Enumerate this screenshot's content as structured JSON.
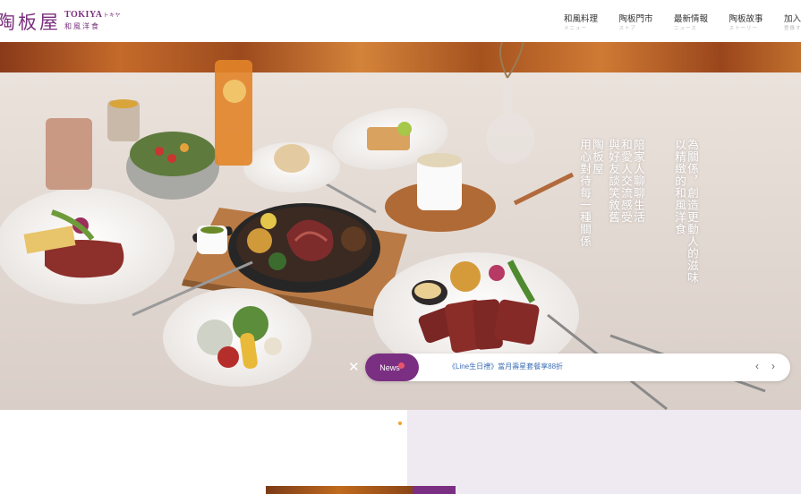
{
  "brand": {
    "name_cn": "陶板屋",
    "name_en": "TOKIYA",
    "name_kana": "トキヤ",
    "tagline": "和風洋食",
    "color": "#7a2f7e"
  },
  "nav": [
    {
      "label": "和風料理",
      "sub": "メニュー"
    },
    {
      "label": "陶板門市",
      "sub": "ストア"
    },
    {
      "label": "最新情報",
      "sub": "ニュース"
    },
    {
      "label": "陶板故事",
      "sub": "ストーリー"
    },
    {
      "label": "加入會",
      "sub": "登錄す"
    }
  ],
  "hero": {
    "slogan_lines": [
      "以精緻的和風洋食",
      "為關係，創造更動人的滋味",
      "陪家人聊聊生活",
      "和愛人交流感受",
      "與好友談笑敘舊",
      "陶板屋",
      "用心對待每一種關係"
    ]
  },
  "news": {
    "tag": "News",
    "text": "《Line生日禮》當月壽星套餐享88折",
    "prev_icon": "chevron-left-icon",
    "next_icon": "chevron-right-icon",
    "close_icon": "close-icon",
    "link_color": "#3d6fb6"
  },
  "carousel": {
    "active_index": 0,
    "count": 2,
    "active_color": "#f2a12b"
  }
}
